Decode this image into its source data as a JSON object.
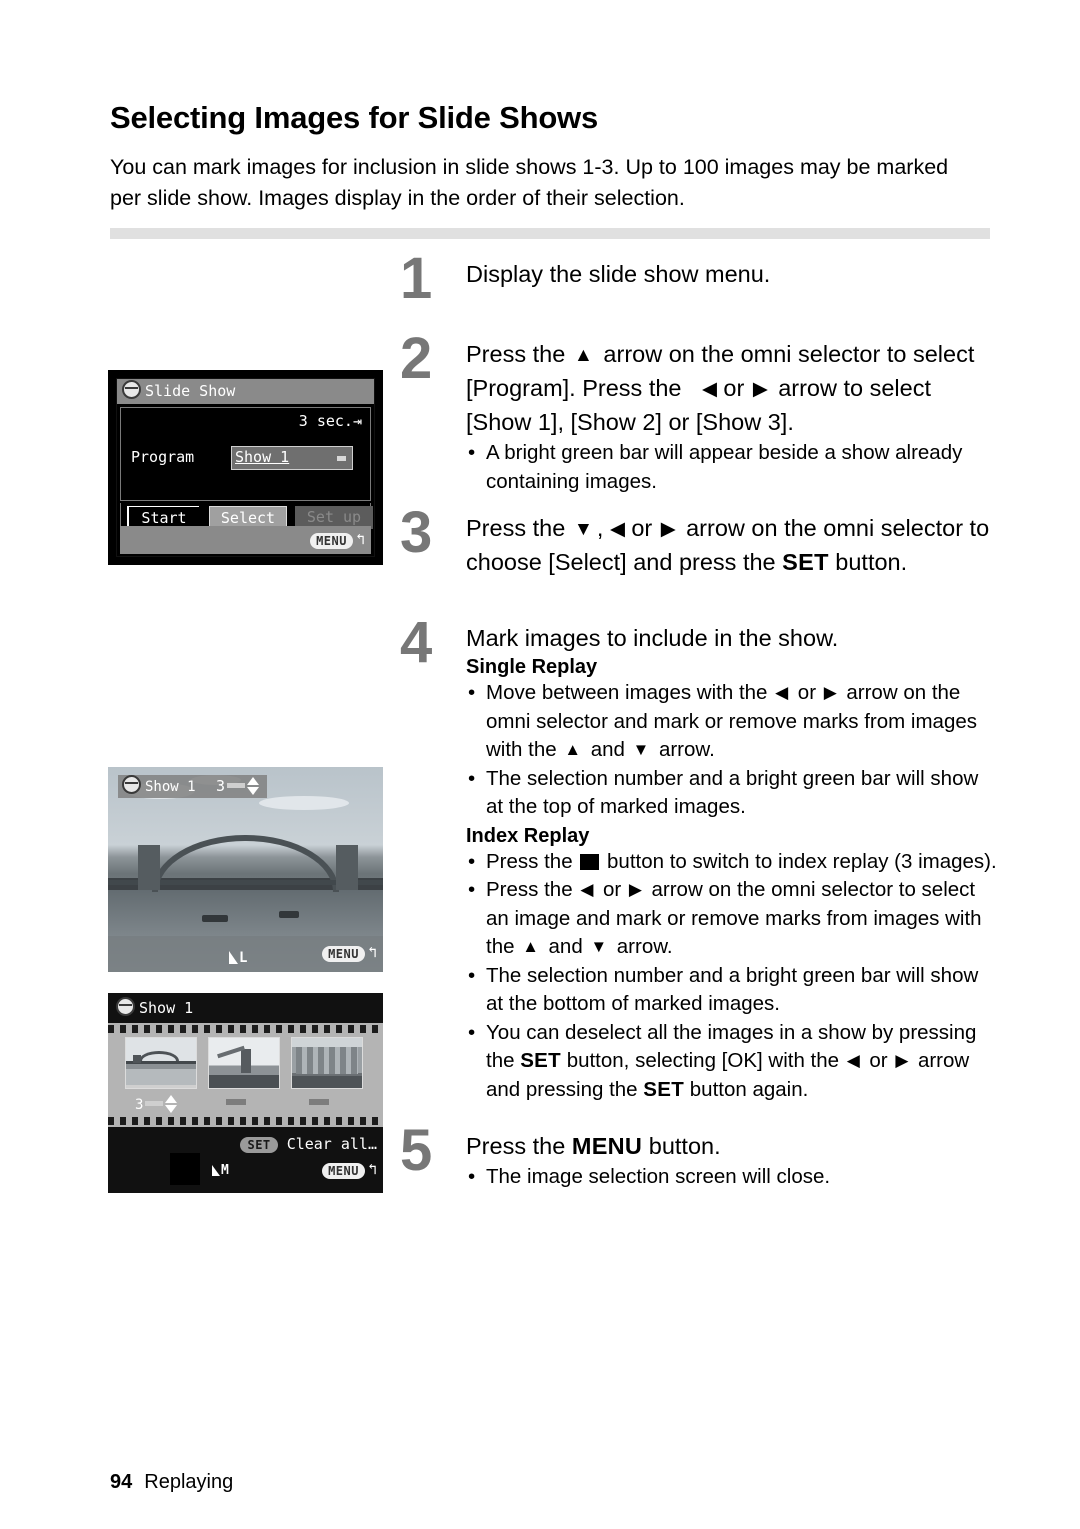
{
  "page": {
    "title": "Selecting Images for Slide Shows",
    "intro": "You can mark images for inclusion in slide shows 1-3. Up to 100 images may be marked per slide show. Images display in the order of their selection.",
    "footer_number": "94",
    "footer_section": "Replaying"
  },
  "steps": [
    {
      "number": "1",
      "title": "Display the slide show menu.",
      "bullets": []
    },
    {
      "number": "2",
      "title_a": "Press the",
      "title_b": "arrow on the omni selector to select [Program]. Press the",
      "title_c": "or",
      "title_d": "arrow to select [Show 1], [Show 2] or [Show 3].",
      "bullets": [
        "A bright green bar will appear beside a show already containing images."
      ]
    },
    {
      "number": "3",
      "title_a": "Press the",
      "title_b": ",",
      "title_c": "or",
      "title_d": "arrow on the omni selector to choose [Select] and press the",
      "title_kw": "SET",
      "title_e": "button.",
      "bullets": []
    },
    {
      "number": "4",
      "title": "Mark images to include in the show.",
      "sub_single": "Single Replay",
      "single_bullets": [
        {
          "a": "Move between images with the",
          "b": "or",
          "c": "arrow on the omni selector and mark or remove marks from images with the",
          "d": "and",
          "e": "arrow."
        },
        {
          "a": "The selection number and a bright green bar will show at the top of marked images."
        }
      ],
      "sub_index": "Index Replay",
      "index_bullets": [
        {
          "a": "Press the",
          "b": "button to switch to index replay (3 images)."
        },
        {
          "a": "Press the",
          "b": "or",
          "c": "arrow on the omni selector to select an image and mark or remove marks from images with the",
          "d": "and",
          "e": "arrow."
        },
        {
          "a": "The selection number and a bright green bar will show at the bottom of marked images."
        },
        {
          "a": "You can deselect all the images in a show by pressing the",
          "kw1": "SET",
          "b": "button, selecting [OK] with the",
          "c": "or",
          "d": "arrow and pressing the",
          "kw2": "SET",
          "e": "button again."
        }
      ]
    },
    {
      "number": "5",
      "title_a": "Press the",
      "title_kw": "MENU",
      "title_b": "button.",
      "bullets": [
        "The image selection screen will close."
      ]
    }
  ],
  "lcd_menu": {
    "title": "Slide Show",
    "duration": "3 sec.",
    "program_label": "Program",
    "program_value": "Show 1",
    "button_start": "Start",
    "button_select": "Select",
    "button_setup": "Set up",
    "menu_pill": "MENU"
  },
  "lcd_single": {
    "show_label": "Show 1",
    "selection_number": "3",
    "quality_label": "L",
    "menu_pill": "MENU"
  },
  "lcd_index": {
    "show_label": "Show 1",
    "selection_number": "3",
    "set_pill": "SET",
    "clear_all": "Clear all…",
    "quality_label": "M",
    "menu_pill": "MENU"
  },
  "icons": {
    "up": "▲",
    "down": "▼",
    "left": "◀",
    "right": "▶",
    "return": "↰",
    "jump": "⇥"
  },
  "colors": {
    "step_number": "#777777",
    "rule": "#e0e0e0",
    "lcd_bg": "#000000",
    "lcd_titlebar": "#8a8a8a"
  }
}
